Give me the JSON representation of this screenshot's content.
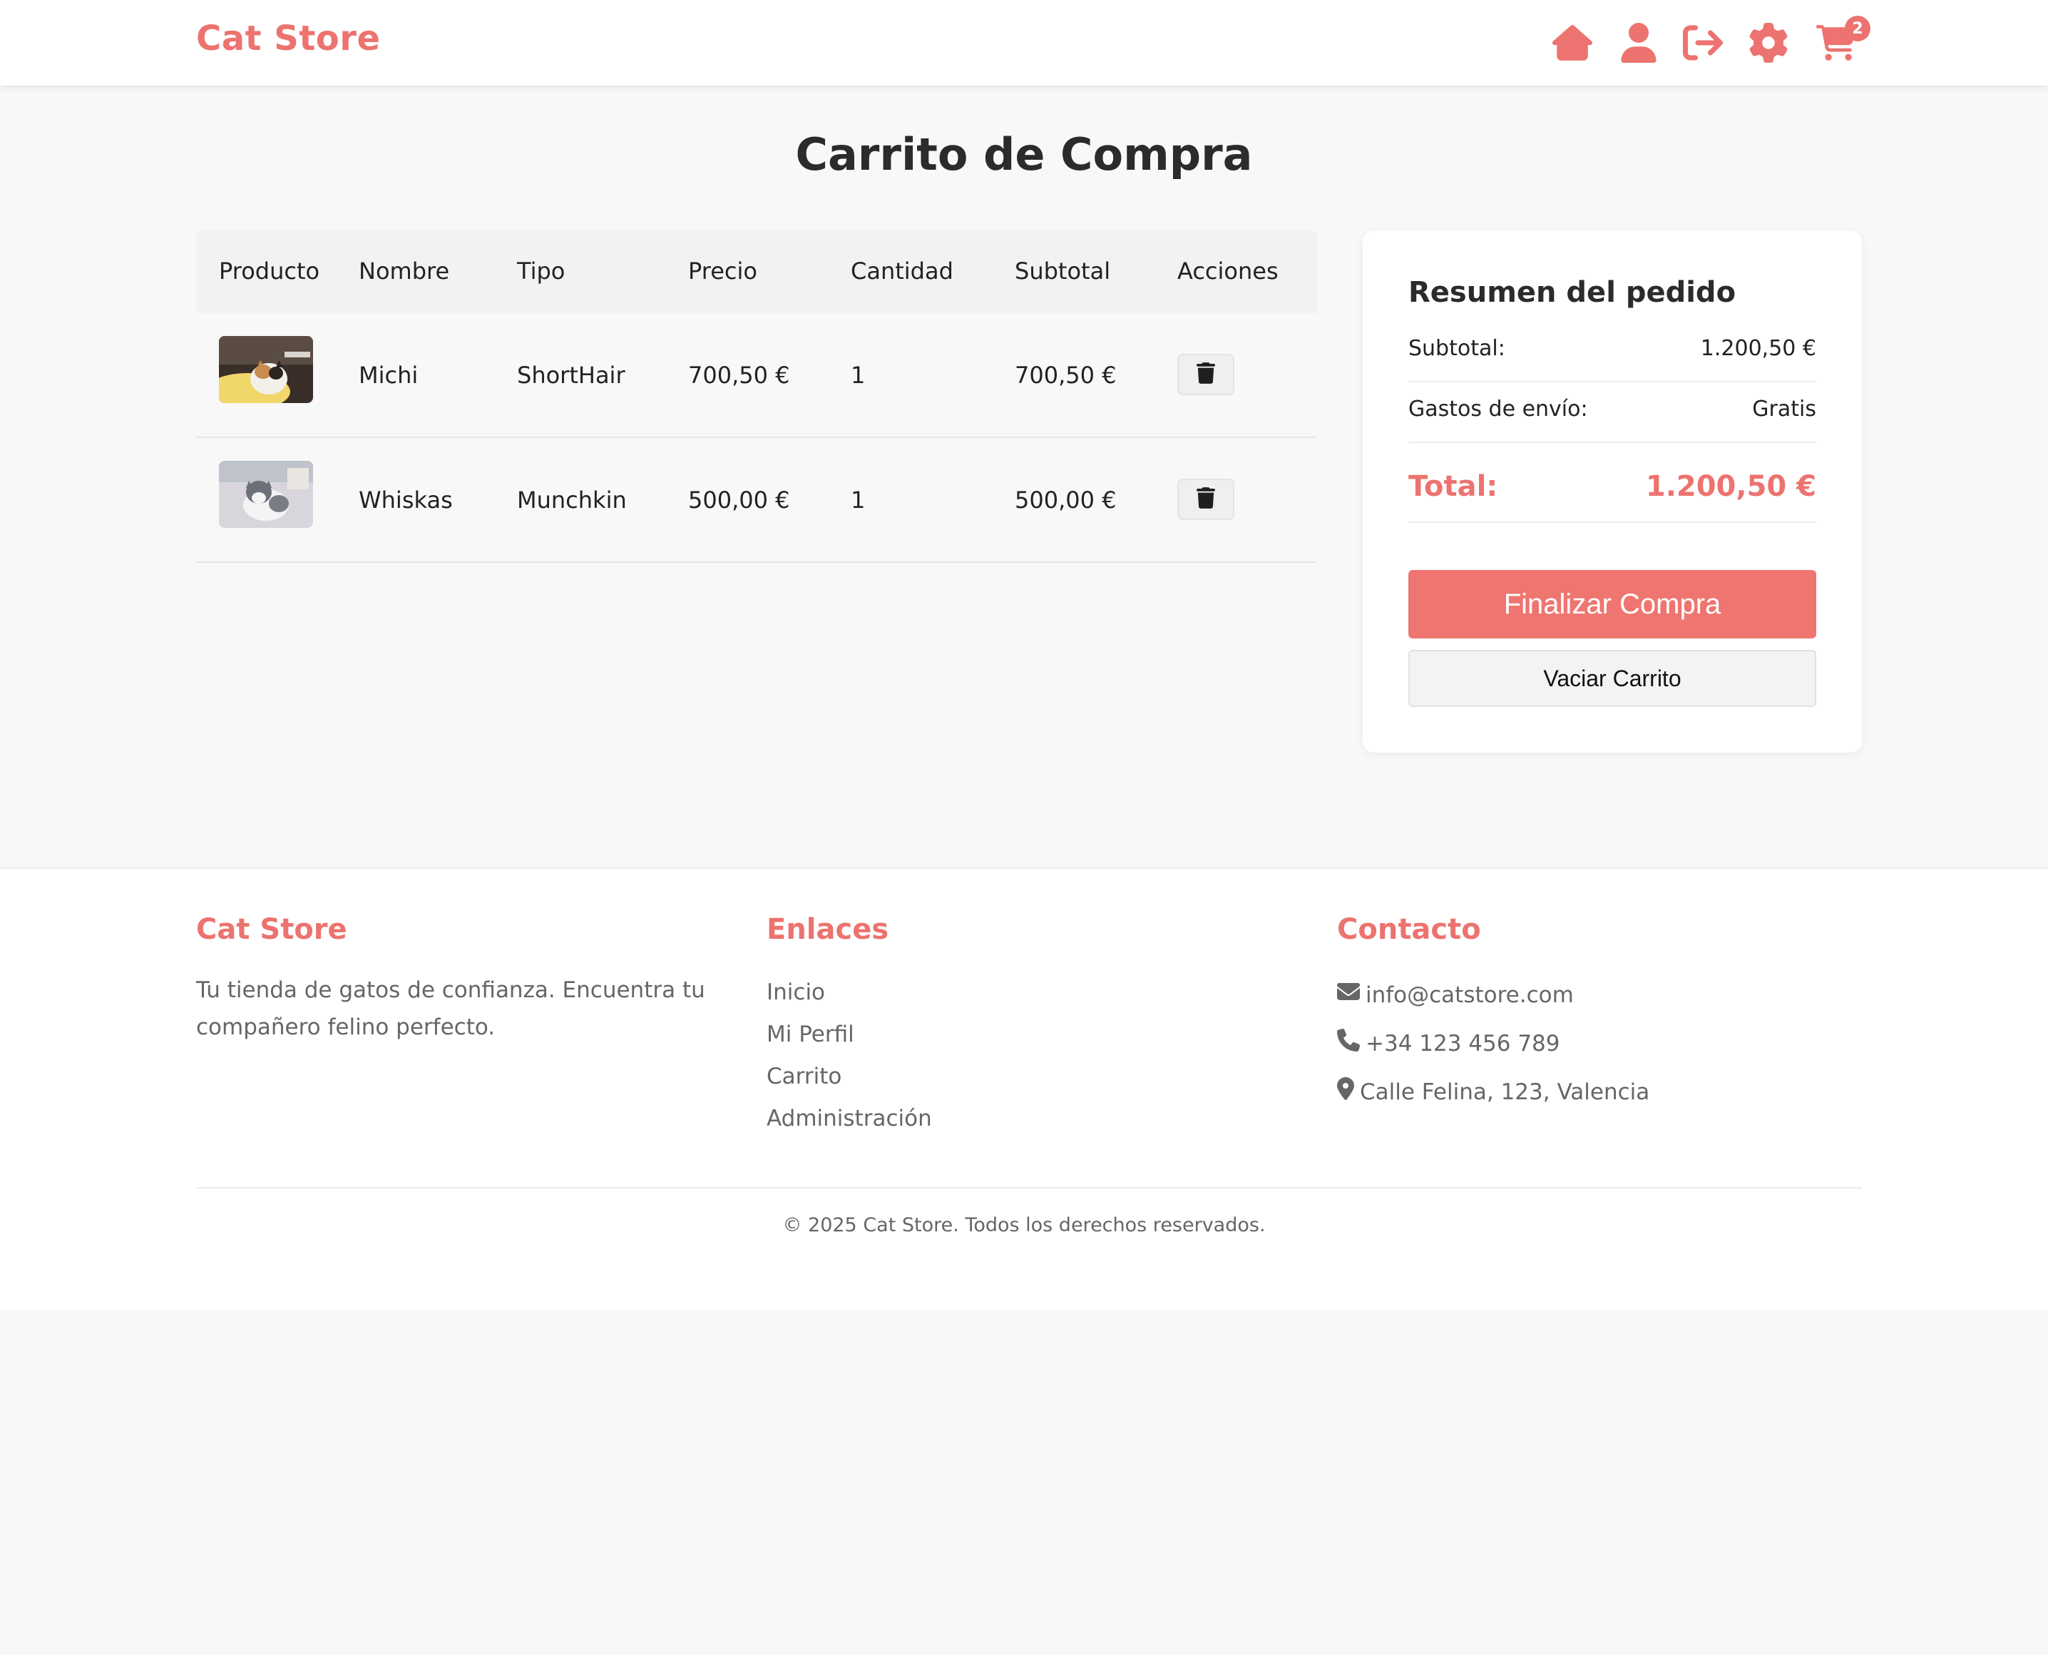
{
  "header": {
    "logo": "Cat Store",
    "cart_count": "2"
  },
  "page_title": "Carrito de Compra",
  "table": {
    "headers": [
      "Producto",
      "Nombre",
      "Tipo",
      "Precio",
      "Cantidad",
      "Subtotal",
      "Acciones"
    ],
    "rows": [
      {
        "nombre": "Michi",
        "tipo": "ShortHair",
        "precio": "700,50 €",
        "cantidad": "1",
        "subtotal": "700,50 €"
      },
      {
        "nombre": "Whiskas",
        "tipo": "Munchkin",
        "precio": "500,00 €",
        "cantidad": "1",
        "subtotal": "500,00 €"
      }
    ]
  },
  "summary": {
    "title": "Resumen del pedido",
    "subtotal_label": "Subtotal:",
    "subtotal_value": "1.200,50 €",
    "shipping_label": "Gastos de envío:",
    "shipping_value": "Gratis",
    "total_label": "Total:",
    "total_value": "1.200,50 €",
    "finalize_label": "Finalizar Compra",
    "empty_label": "Vaciar Carrito"
  },
  "footer": {
    "brand_title": "Cat Store",
    "brand_text_1": "Tu tienda de gatos de confianza. Encuentra tu",
    "brand_text_2": "compañero felino perfecto.",
    "links_title": "Enlaces",
    "links": [
      "Inicio",
      "Mi Perfil",
      "Carrito",
      "Administración"
    ],
    "contact_title": "Contacto",
    "email": "info@catstore.com",
    "phone": "+34 123 456 789",
    "address": "Calle Felina, 123, Valencia",
    "copyright": "© 2025 Cat Store. Todos los derechos reservados."
  },
  "colors": {
    "accent": "#ec736f",
    "background": "#f8f8f8"
  }
}
